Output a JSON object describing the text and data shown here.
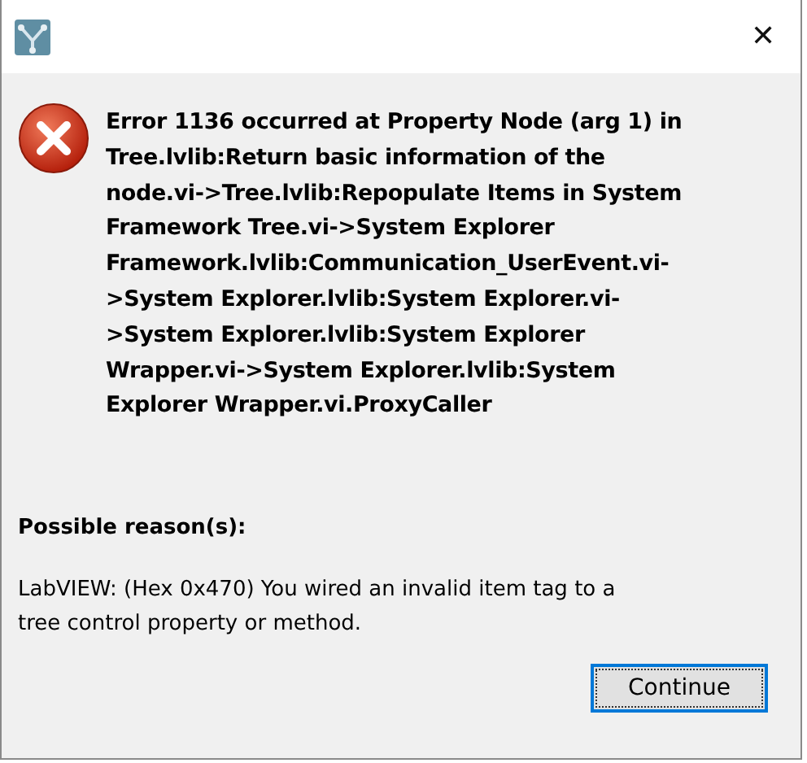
{
  "window": {
    "close_label": "✕"
  },
  "error": {
    "message_lines": [
      "Error 1136 occurred at Property Node (arg 1) in",
      "Tree.lvlib:Return basic information of the",
      "node.vi->Tree.lvlib:Repopulate Items in System",
      "Framework Tree.vi->System Explorer",
      "Framework.lvlib:Communication_UserEvent.vi-",
      ">System Explorer.lvlib:System Explorer.vi-",
      ">System Explorer.lvlib:System Explorer",
      "Wrapper.vi->System Explorer.lvlib:System",
      "Explorer Wrapper.vi.ProxyCaller"
    ]
  },
  "reason": {
    "heading": "Possible reason(s):",
    "lines": [
      "LabVIEW: (Hex 0x470) You wired an invalid item tag to a",
      "tree control property or method."
    ]
  },
  "buttons": [
    {
      "label": "Continue",
      "selected": true
    }
  ]
}
